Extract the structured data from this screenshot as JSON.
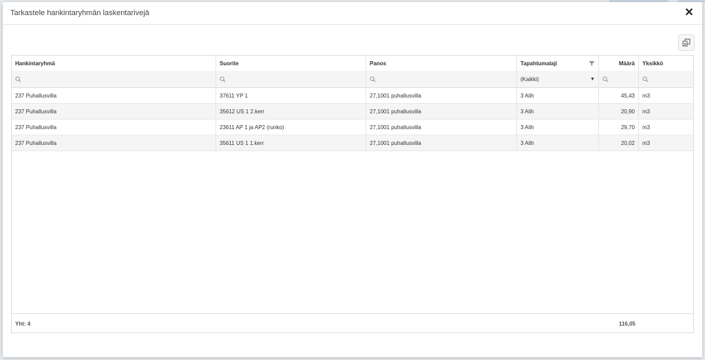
{
  "dialog": {
    "title": "Tarkastele hankintaryhmän laskentarivejä",
    "close_glyph": "✕"
  },
  "grid": {
    "columns": [
      "Hankintaryhmä",
      "Suorite",
      "Panos",
      "Tapahtumalaji",
      "Määrä",
      "Yksikkö"
    ],
    "filter": {
      "tapahtumalaji_selected": "(Kaikki)"
    },
    "rows": [
      [
        "237 Puhallusvilla",
        "37611 YP 1",
        "27,1001 puhallusvilla",
        "3 Alih",
        "45,43",
        "m3"
      ],
      [
        "237 Puhallusvilla",
        "35612 US 1 2.kerr",
        "27,1001 puhallusvilla",
        "3 Alih",
        "20,90",
        "m3"
      ],
      [
        "237 Puhallusvilla",
        "23611 AP 1 ja AP2 (runko)",
        "27,1001 puhallusvilla",
        "3 Alih",
        "29,70",
        "m3"
      ],
      [
        "237 Puhallusvilla",
        "35611 US 1 1.kerr",
        "27,1001 puhallusvilla",
        "3 Alih",
        "20,02",
        "m3"
      ]
    ],
    "footer": {
      "count_label": "Yht: 4",
      "sum_label": "116,05"
    }
  },
  "icons": {
    "export": "export-icon",
    "search": "search-icon",
    "filter": "filter-icon",
    "dropdown": "caret-down-icon",
    "close": "close-icon"
  },
  "colors": {
    "header_border": "#dddddd",
    "alt_row": "#f5f5f5",
    "icon": "#8a8a8a"
  }
}
